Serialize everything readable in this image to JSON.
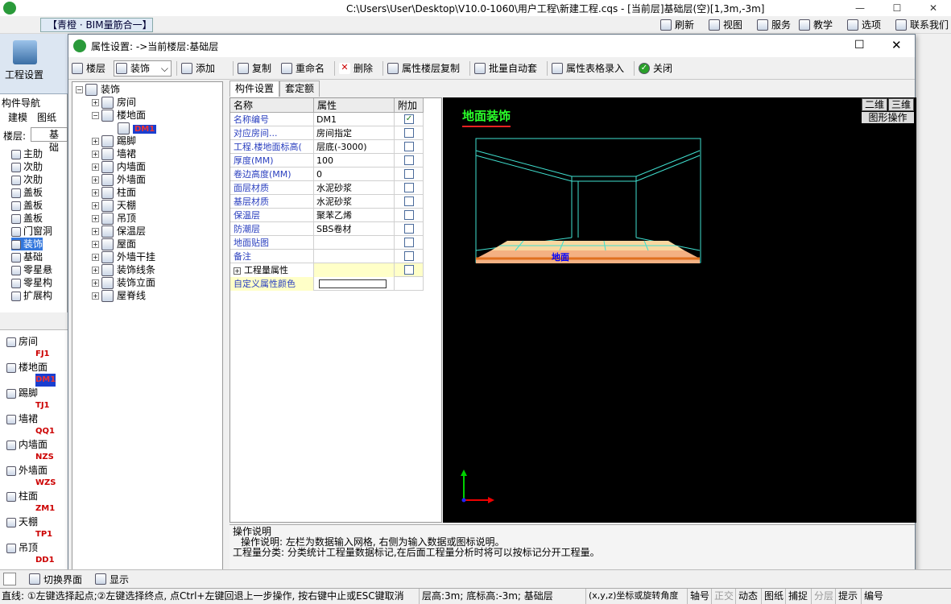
{
  "window": {
    "title": "C:\\Users\\User\\Desktop\\V10.0-1060\\用户工程\\新建工程.cqs - [当前层]基础层(空)[1,3m,-3m]",
    "minimize": "—",
    "maximize": "☐",
    "close": "✕"
  },
  "app_tab": "【青橙 · BIM量筋合一】",
  "top_toolbar": [
    "刷新",
    "视图",
    "服务",
    "教学",
    "选项",
    "联系我们"
  ],
  "left": {
    "ribbon_label": "工程设置",
    "nav_title": "构件导航",
    "tabs": [
      "建模",
      "图纸"
    ],
    "floor_label": "楼层:",
    "floor_value": "基础",
    "items": [
      "主肋",
      "次肋",
      "次肋",
      "盖板",
      "盖板",
      "盖板",
      "门窗洞",
      "装饰",
      "基础",
      "零星悬",
      "零星构",
      "扩展构"
    ],
    "lower_items": [
      {
        "name": "房间",
        "code": "FJ1"
      },
      {
        "name": "楼地面",
        "code": "DM1"
      },
      {
        "name": "踢脚",
        "code": "TJ1"
      },
      {
        "name": "墙裙",
        "code": "QQ1"
      },
      {
        "name": "内墙面",
        "code": "NZS"
      },
      {
        "name": "外墙面",
        "code": "WZS"
      },
      {
        "name": "柱面",
        "code": "ZM1"
      },
      {
        "name": "天棚",
        "code": "TP1"
      },
      {
        "name": "吊顶",
        "code": "DD1"
      }
    ]
  },
  "dialog": {
    "title": "属性设置: ->当前楼层:基础层",
    "maximize": "☐",
    "close": "✕",
    "toolbar": {
      "floor": "楼层",
      "category": "装饰",
      "add": "添加",
      "copy": "复制",
      "rename": "重命名",
      "delete": "删除",
      "copy_floor": "属性楼层复制",
      "batch": "批量自动套",
      "table_input": "属性表格录入",
      "close": "关闭"
    },
    "tree": {
      "root": "装饰",
      "nodes": [
        "房间",
        "楼地面",
        "DM1",
        "踢脚",
        "墙裙",
        "内墙面",
        "外墙面",
        "柱面",
        "天棚",
        "吊顶",
        "保温层",
        "屋面",
        "外墙干挂",
        "装饰线条",
        "装饰立面",
        "屋脊线"
      ]
    },
    "tabs": [
      "构件设置",
      "套定额"
    ],
    "grid": {
      "headers": [
        "名称",
        "属性",
        "附加"
      ],
      "rows": [
        {
          "name": "名称编号",
          "value": "DM1",
          "checked": true
        },
        {
          "name": "对应房间...",
          "value": "房间指定",
          "checked": false
        },
        {
          "name": "工程.楼地面标高(",
          "value": "层底(-3000)",
          "checked": false
        },
        {
          "name": "厚度(MM)",
          "value": "100",
          "checked": false
        },
        {
          "name": "卷边高度(MM)",
          "value": "0",
          "checked": false
        },
        {
          "name": "面层材质",
          "value": "水泥砂浆",
          "checked": false
        },
        {
          "name": "基层材质",
          "value": "水泥砂浆",
          "checked": false
        },
        {
          "name": "保温层",
          "value": "聚苯乙烯",
          "checked": false
        },
        {
          "name": "防潮层",
          "value": "SBS卷材",
          "checked": false
        },
        {
          "name": "地面贴图",
          "value": "",
          "checked": false
        },
        {
          "name": "备注",
          "value": "",
          "checked": false
        }
      ],
      "group_row": "工程量属性",
      "color_row": "自定义属性颜色"
    },
    "preview": {
      "title": "地面装饰",
      "label": "地面",
      "btn_2d": "二维",
      "btn_3d": "三维",
      "btn_ops": "图形操作"
    },
    "help": {
      "title": "操作说明",
      "line1": "操作说明: 左栏为数据输入网格, 右侧为输入数据或图标说明。",
      "line2": "工程量分类: 分类统计工程量数据标记,在后面工程量分析时将可以按标记分开工程量。"
    }
  },
  "bottom_tabs": [
    "切换界面",
    "显示"
  ],
  "status": {
    "text": "直线: ①左键选择起点;②左键选择终点, 点Ctrl+左键回退上一步操作, 按右键中止或ESC键取消",
    "floor": "层高:3m; 底标高:-3m; 基础层",
    "coord": "(x,y,z)坐标或旋转角度",
    "items": [
      "轴号",
      "正交",
      "动态",
      "图纸",
      "捕捉",
      "分层",
      "提示",
      "编号"
    ]
  },
  "colors": {
    "accent": "#2a3fbf",
    "preview_title": "#2aff2a",
    "wire": "#40e0d0",
    "floor": "#f4b183"
  }
}
